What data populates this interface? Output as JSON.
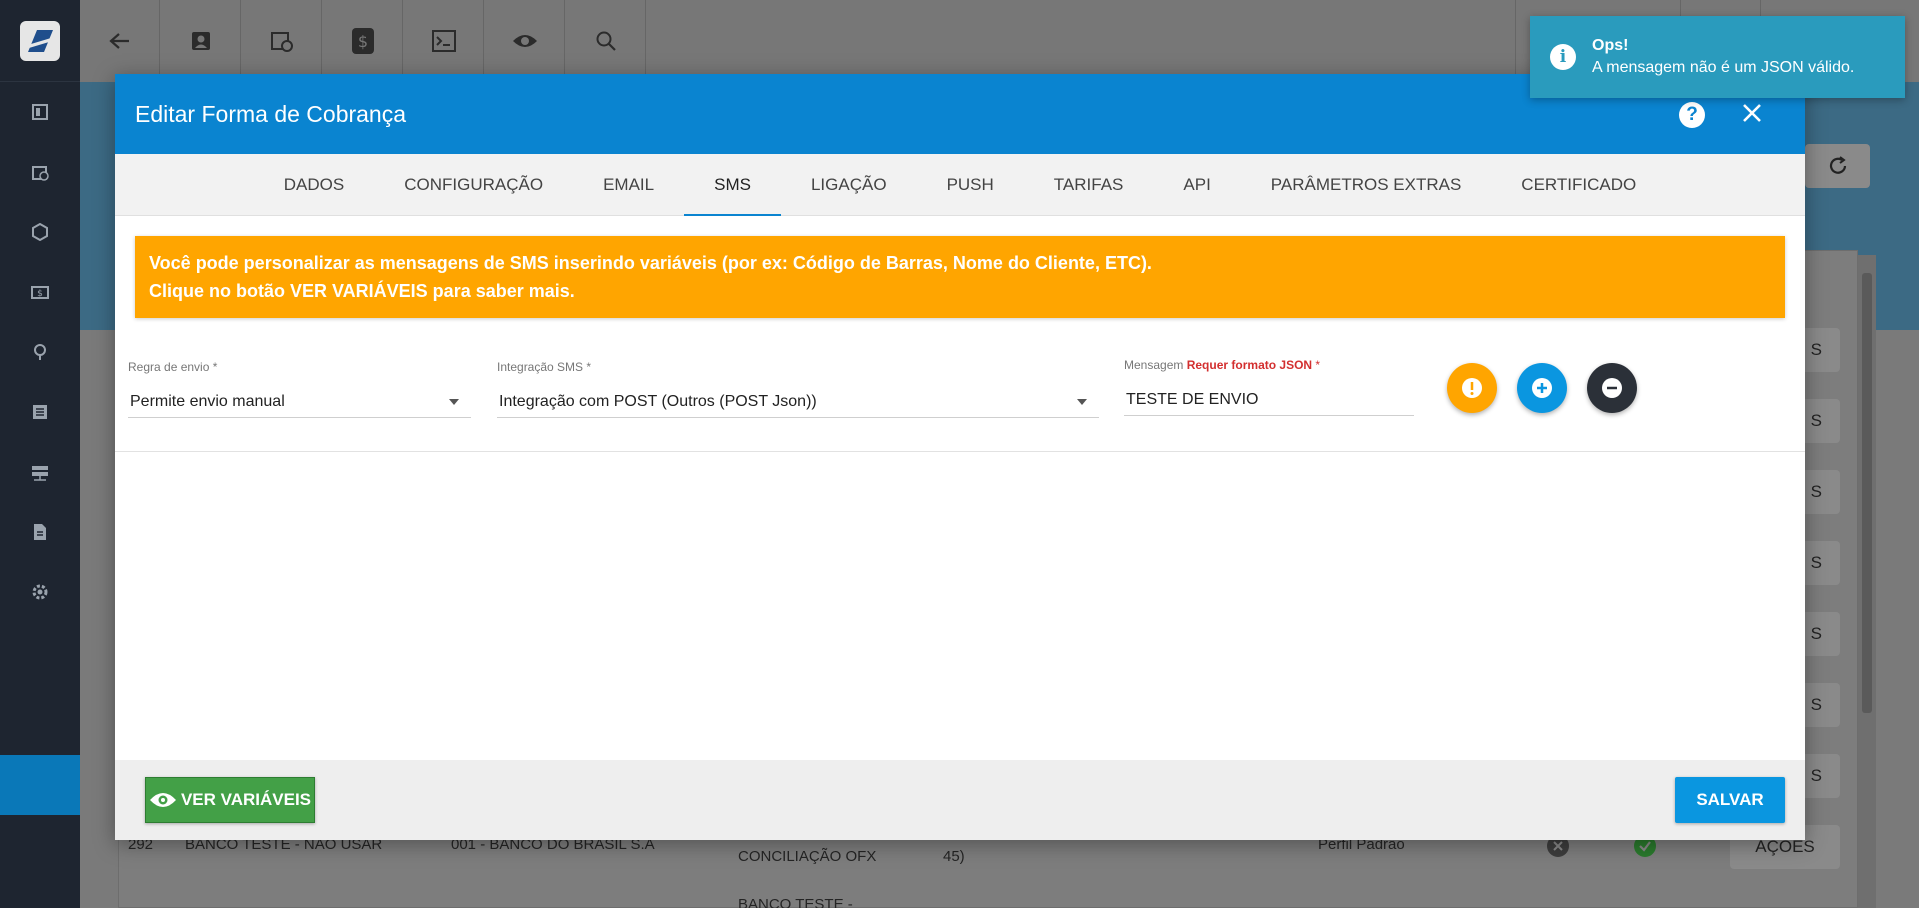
{
  "background": {
    "acoes_label": "AÇOES",
    "rows": [
      {
        "id": "292",
        "name": "BANCO TESTE - NAO USAR",
        "bank": "001 - BANCO DO BRASIL S.A",
        "type": "CONCILIAÇÃO OFX",
        "extra": "45)",
        "profile": "Perfil Padrão"
      },
      {
        "type": "BANCO TESTE -"
      }
    ]
  },
  "modal": {
    "title": "Editar Forma de Cobrança",
    "tabs": [
      "DADOS",
      "CONFIGURAÇÃO",
      "EMAIL",
      "SMS",
      "LIGAÇÃO",
      "PUSH",
      "TARIFAS",
      "API",
      "PARÂMETROS EXTRAS",
      "CERTIFICADO"
    ],
    "active_tab": "SMS",
    "alert": {
      "line1": "Você pode personalizar as mensagens de SMS inserindo variáveis (por ex: Código de Barras, Nome do Cliente, ETC).",
      "line2": "Clique no botão VER VARIÁVEIS para saber mais."
    },
    "form": {
      "regra_label": "Regra de envio *",
      "regra_value": "Permite envio manual",
      "integracao_label": "Integração SMS *",
      "integracao_value": "Integração com POST (Outros (POST Json))",
      "mensagem_label": "Mensagem",
      "mensagem_req": "Requer formato JSON",
      "mensagem_star": "*",
      "mensagem_value": "TESTE DE ENVIO"
    },
    "footer": {
      "vars_label": "VER VARIÁVEIS",
      "save_label": "SALVAR"
    }
  },
  "toast": {
    "title": "Ops!",
    "message": "A mensagem não é um JSON válido."
  },
  "colors": {
    "header": "#0a84d0",
    "alert": "#ffa500",
    "vars_button": "#43a047",
    "save_button": "#0a96e0",
    "toast": "#2a9bbd"
  }
}
